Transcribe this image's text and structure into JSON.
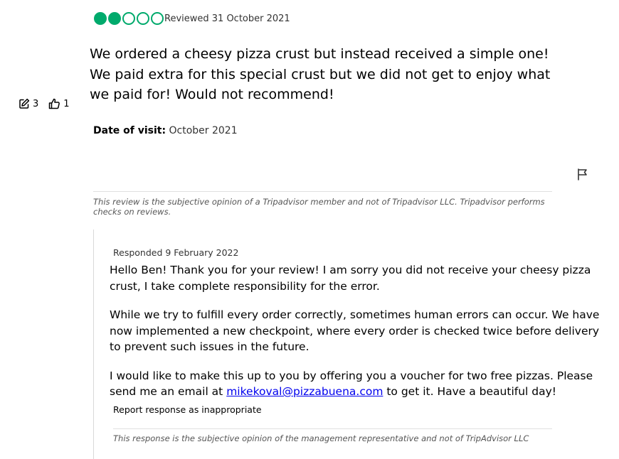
{
  "review": {
    "rating": 2,
    "rating_max": 5,
    "rating_color": "#00aa6c",
    "reviewed_text": "Reviewed 31 October 2021",
    "body": "We ordered a cheesy pizza crust but instead received a simple one! We paid extra for this special crust but we did not get to enjoy what we paid for! Would not recommend!",
    "date_of_visit_label": "Date of visit:",
    "date_of_visit_value": "October 2021",
    "disclaimer": "This review is the subjective opinion of a Tripadvisor member and not of Tripadvisor LLC. Tripadvisor performs checks on reviews."
  },
  "stats": {
    "contributions_icon": "edit-icon",
    "contributions": "3",
    "helpful_icon": "thumbs-up-icon",
    "helpful_votes": "1"
  },
  "flag_icon": "flag-icon",
  "response": {
    "responded_text": "Responded 9 February 2022",
    "paragraph1": "Hello Ben! Thank you for your review! I am sorry you did not receive your cheesy pizza crust, I take complete responsibility for the error.",
    "paragraph2": "While we try to fulfill every order correctly, sometimes human errors can occur. We have now implemented a new checkpoint, where every order is checked twice before delivery to prevent such issues in the future.",
    "paragraph3_before": "I would like to make this up to you by offering you a voucher for two free pizzas. Please send me an email at ",
    "email": "mikekoval@pizzabuena.com",
    "paragraph3_after": " to get it. Have a beautiful day!",
    "report_link": "Report response as inappropriate",
    "disclaimer": "This response is the subjective opinion of the management representative and not of TripAdvisor LLC"
  }
}
